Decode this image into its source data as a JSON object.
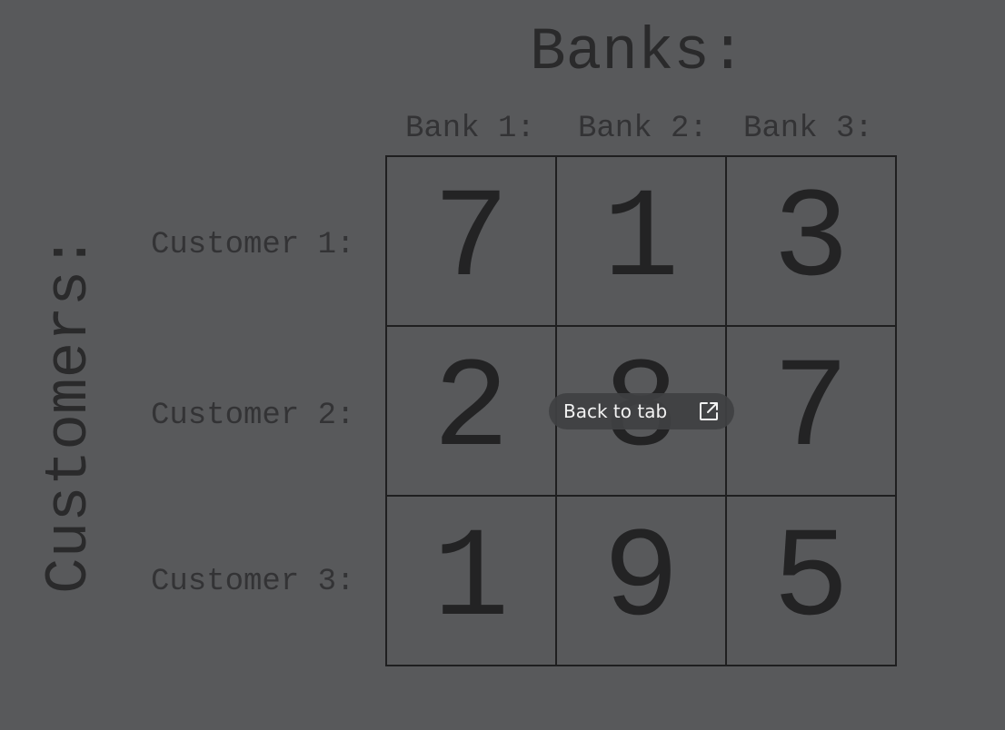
{
  "title": "Banks:",
  "side_title": "Customers:",
  "bank_headers": [
    "Bank 1:",
    "Bank 2:",
    "Bank 3:"
  ],
  "customer_labels": [
    "Customer 1:",
    "Customer 2:",
    "Customer 3:"
  ],
  "matrix": [
    [
      "7",
      "1",
      "3"
    ],
    [
      "2",
      "8",
      "7"
    ],
    [
      "1",
      "9",
      "5"
    ]
  ],
  "overlay": {
    "label": "Back to tab",
    "icon": "open-external-icon"
  },
  "colors": {
    "background": "#58595b",
    "text": "#2a2a2b",
    "overlay_bg": "#404143",
    "overlay_text": "#f2f2f2"
  }
}
